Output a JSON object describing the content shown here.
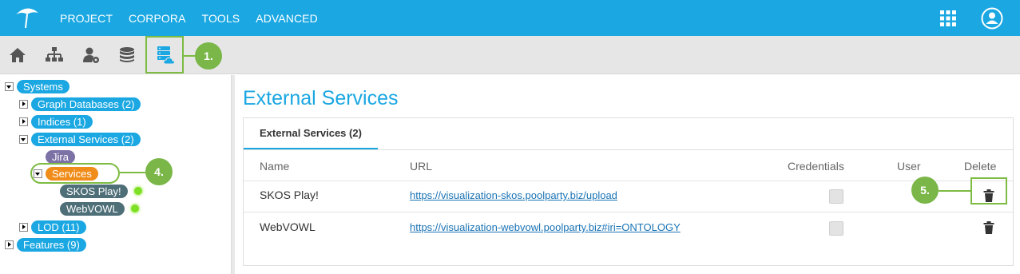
{
  "topbar": {
    "nav": [
      "PROJECT",
      "CORPORA",
      "TOOLS",
      "ADVANCED"
    ],
    "logo_icon": "umbrella-icon",
    "apps_icon": "apps-grid-icon",
    "user_icon": "user-account-icon",
    "bg_color": "#1aa7e2"
  },
  "toolbar": {
    "icons": [
      "home-icon",
      "hierarchy-icon",
      "user-settings-icon",
      "database-icon",
      "external-services-icon"
    ],
    "active": "external-services-icon"
  },
  "callouts": {
    "c1": "1.",
    "c4": "4.",
    "c5": "5."
  },
  "tree": {
    "root": "Systems",
    "graph_databases": "Graph Databases (2)",
    "indices": "Indices (1)",
    "external_services": "External Services (2)",
    "jira": "Jira",
    "services": "Services",
    "skos_play": "SKOS Play!",
    "webvowl": "WebVOWL",
    "lod": "LOD (11)",
    "features": "Features (9)"
  },
  "main": {
    "title": "External Services",
    "tab": "External Services (2)",
    "columns": {
      "name": "Name",
      "url": "URL",
      "credentials": "Credentials",
      "user": "User",
      "delete": "Delete"
    },
    "rows": [
      {
        "name": "SKOS Play!",
        "url": "https://visualization-skos.poolparty.biz/upload",
        "credentials": false,
        "user": ""
      },
      {
        "name": "WebVOWL",
        "url": "https://visualization-webvowl.poolparty.biz#iri=ONTOLOGY",
        "credentials": false,
        "user": ""
      }
    ]
  },
  "colors": {
    "accent": "#1aa7e2",
    "highlight": "#7dbb42",
    "status_online": "#7ee024"
  }
}
